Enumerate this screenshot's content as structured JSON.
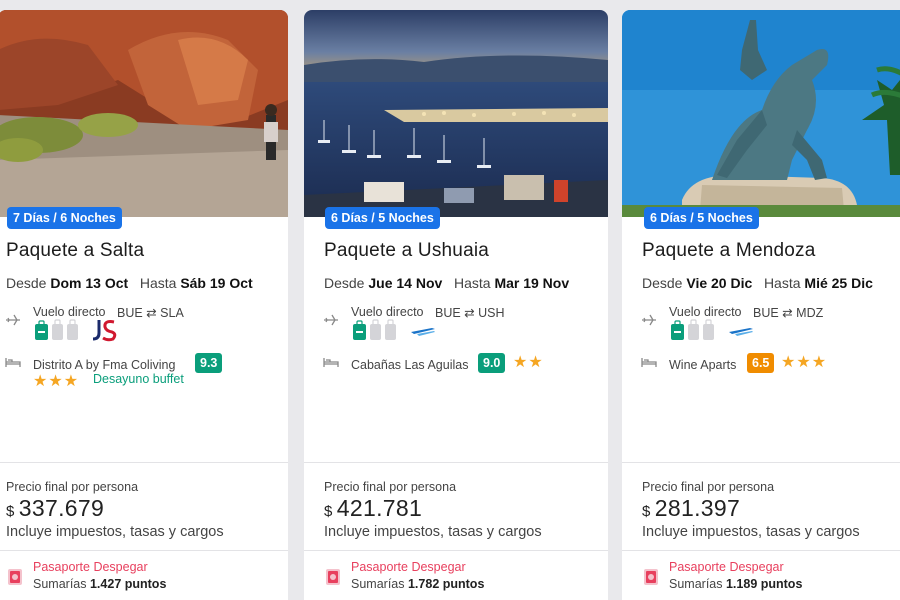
{
  "cards": [
    {
      "duration": "7 Días / 6 Noches",
      "title": "Paquete a Salta",
      "from_label": "Desde",
      "from_date": "Dom 13 Oct",
      "to_label": "Hasta",
      "to_date": "Sáb 19 Oct",
      "flight_label": "Vuelo directo",
      "origin": "BUE",
      "destination": "SLA",
      "route_arrow": "⇄",
      "airline_icon": "jetsmart-logo",
      "hotel_name": "Distrito A by Fma Coliving",
      "hotel_score": "9.3",
      "score_color": "#0a9e7b",
      "stars": "★★★",
      "amenity": "Desayuno buffet",
      "price_label": "Precio final por persona",
      "currency": "$",
      "price": "337.679",
      "taxes": "Incluye impuestos, tasas y cargos",
      "passport_title": "Pasaporte Despegar",
      "points_prefix": "Sumarías",
      "points": "1.427 puntos"
    },
    {
      "duration": "6 Días / 5 Noches",
      "title": "Paquete a Ushuaia",
      "from_label": "Desde",
      "from_date": "Jue 14 Nov",
      "to_label": "Hasta",
      "to_date": "Mar 19 Nov",
      "flight_label": "Vuelo directo",
      "origin": "BUE",
      "destination": "USH",
      "route_arrow": "⇄",
      "airline_icon": "aerolineas-argentinas-logo",
      "hotel_name": "Cabañas Las Aguilas",
      "hotel_score": "9.0",
      "score_color": "#0a9e7b",
      "stars": "★★",
      "amenity": "",
      "price_label": "Precio final por persona",
      "currency": "$",
      "price": "421.781",
      "taxes": "Incluye impuestos, tasas y cargos",
      "passport_title": "Pasaporte Despegar",
      "points_prefix": "Sumarías",
      "points": "1.782 puntos"
    },
    {
      "duration": "6 Días / 5 Noches",
      "title": "Paquete a Mendoza",
      "from_label": "Desde",
      "from_date": "Vie 20 Dic",
      "to_label": "Hasta",
      "to_date": "Mié 25 Dic",
      "flight_label": "Vuelo directo",
      "origin": "BUE",
      "destination": "MDZ",
      "route_arrow": "⇄",
      "airline_icon": "aerolineas-argentinas-logo",
      "hotel_name": "Wine Aparts",
      "hotel_score": "6.5",
      "score_color": "#f08c00",
      "stars": "★★★",
      "amenity": "",
      "price_label": "Precio final por persona",
      "currency": "$",
      "price": "281.397",
      "taxes": "Incluye impuestos, tasas y cargos",
      "passport_title": "Pasaporte Despegar",
      "points_prefix": "Sumarías",
      "points": "1.189 puntos"
    }
  ]
}
